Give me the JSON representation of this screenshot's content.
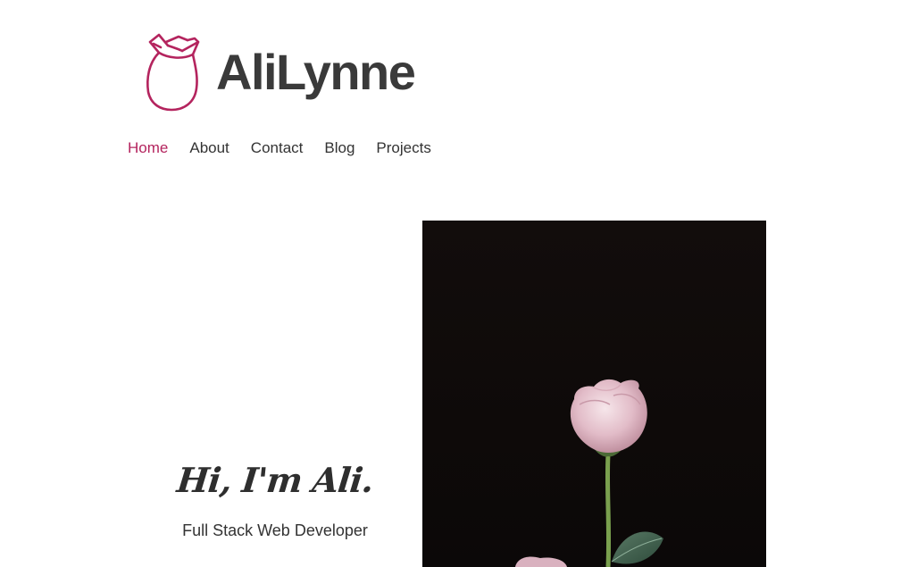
{
  "header": {
    "brand_name": "AliLynne",
    "logo_icon": "rose-icon",
    "brand_color": "#b4245e"
  },
  "nav": {
    "items": [
      {
        "label": "Home",
        "active": true
      },
      {
        "label": "About",
        "active": false
      },
      {
        "label": "Contact",
        "active": false
      },
      {
        "label": "Blog",
        "active": false
      },
      {
        "label": "Projects",
        "active": false
      }
    ]
  },
  "hero": {
    "greeting": "Hi, I'm Ali.",
    "subtitle": "Full Stack Web Developer",
    "image_subject": "pink rose on black background"
  }
}
